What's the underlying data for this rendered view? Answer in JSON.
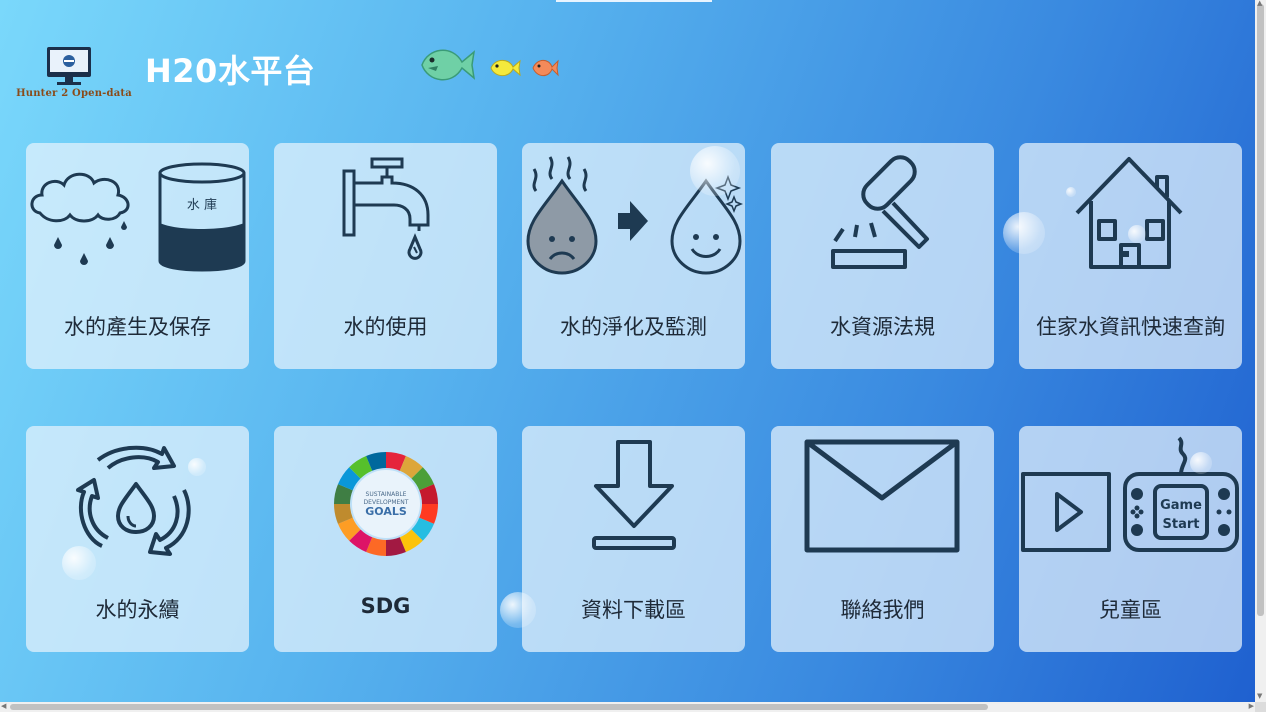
{
  "header": {
    "logo_text": "Hunter 2 Open-data",
    "title": "H20水平台"
  },
  "cards": [
    {
      "label": "水的產生及保存",
      "icon": "rain-reservoir-icon",
      "reservoir_text": "水 庫"
    },
    {
      "label": "水的使用",
      "icon": "faucet-icon"
    },
    {
      "label": "水的淨化及監測",
      "icon": "purify-drop-icon"
    },
    {
      "label": "水資源法規",
      "icon": "gavel-icon"
    },
    {
      "label": "住家水資訊快速查詢",
      "icon": "house-icon"
    },
    {
      "label": "水的永續",
      "icon": "recycle-drop-icon"
    },
    {
      "label": "SDG",
      "icon": "sdg-wheel-icon",
      "sdg_text_1": "SUSTAINABLE",
      "sdg_text_2": "DEVELOPMENT",
      "sdg_text_3": "GOALS"
    },
    {
      "label": "資料下載區",
      "icon": "download-icon"
    },
    {
      "label": "聯絡我們",
      "icon": "envelope-icon"
    },
    {
      "label": "兒童區",
      "icon": "game-icon",
      "game_text_1": "Game",
      "game_text_2": "Start"
    }
  ],
  "colors": {
    "icon_stroke": "#1e3a52",
    "label_text": "#1e2a38"
  }
}
